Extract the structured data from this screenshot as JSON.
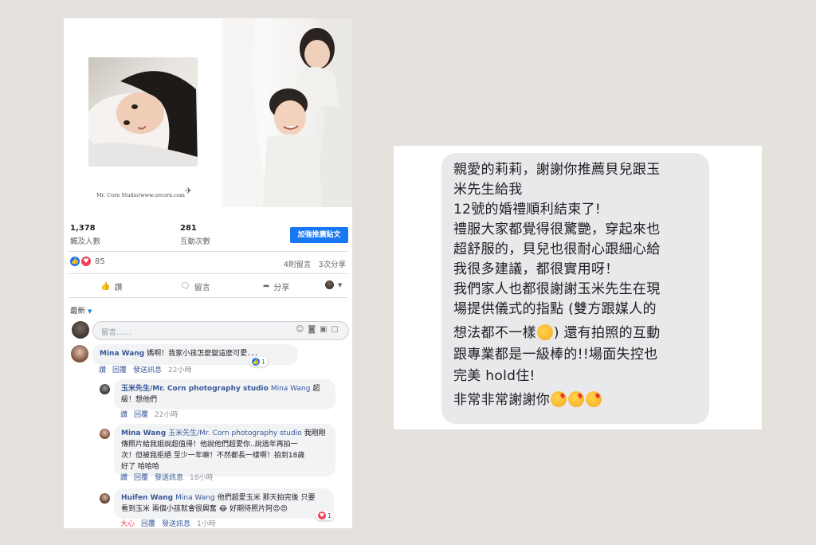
{
  "post": {
    "photo_credit": "Mr. Corn Studio/www.urcorn.com",
    "reach_num": "1,378",
    "reach_label": "觸及人數",
    "engage_num": "281",
    "engage_label": "互動次數",
    "boost_label": "加強推廣貼文",
    "reaction_count": "85",
    "comments_count": "4則留言",
    "shares_count": "3次分享",
    "like_label": "讚",
    "comment_label": "留言",
    "share_label": "分享",
    "sort_label": "最新",
    "comment_placeholder": "留言……"
  },
  "comments": [
    {
      "author": "Mina Wang",
      "text": "媽啊！我家小孩怎麼變這麼可愛．．．",
      "actions": [
        "讚",
        "回覆",
        "發送訊息"
      ],
      "time": "22小時",
      "reactions": "1"
    },
    {
      "author": "玉米先生/Mr. Corn photography studio",
      "tag": "Mina Wang",
      "text_line1": "超",
      "text_line2": "級！想他們",
      "actions": [
        "讚",
        "回覆"
      ],
      "time": "22小時"
    },
    {
      "author": "Mina Wang",
      "tag": "玉米先生/Mr. Corn photography studio",
      "text_line1": "我剛剛",
      "lines": [
        "傳照片給我姐說超值得！他說他們超愛你..說過年再拍一",
        "次！但被我拒絕 至少一年嘛！不然都長一樣啊！拍到18歲",
        "好了 哈哈哈"
      ],
      "actions": [
        "讚",
        "回覆",
        "發送訊息"
      ],
      "time": "18小時"
    },
    {
      "author": "Huifen Wang",
      "tag": "Mina Wang",
      "text_line1": "他們超愛玉米 那天拍完後 只要",
      "text_line2": "看到玉米 兩個小孩就會很興奮",
      "text_line2b": "好期待照片阿",
      "actions": [
        "大心",
        "回覆",
        "發送訊息"
      ],
      "time": "1小時",
      "reactions": "1"
    }
  ],
  "message": {
    "lines": [
      "親愛的莉莉，謝謝你推薦貝兒跟玉",
      "米先生給我",
      "12號的婚禮順利結束了!",
      "禮服大家都覺得很驚艷，穿起來也",
      "超舒服的，貝兒也很耐心跟細心給",
      "我很多建議，都很實用呀！",
      "我們家人也都很謝謝玉米先生在現",
      "場提供儀式的指點 (雙方跟媒人的"
    ],
    "line9a": "想法都不一樣",
    "line9b": ") 還有拍照的互動",
    "line10": "跟專業都是一級棒的!!場面失控也",
    "line11": "完美 hold住!",
    "line12": "非常非常謝謝你"
  }
}
